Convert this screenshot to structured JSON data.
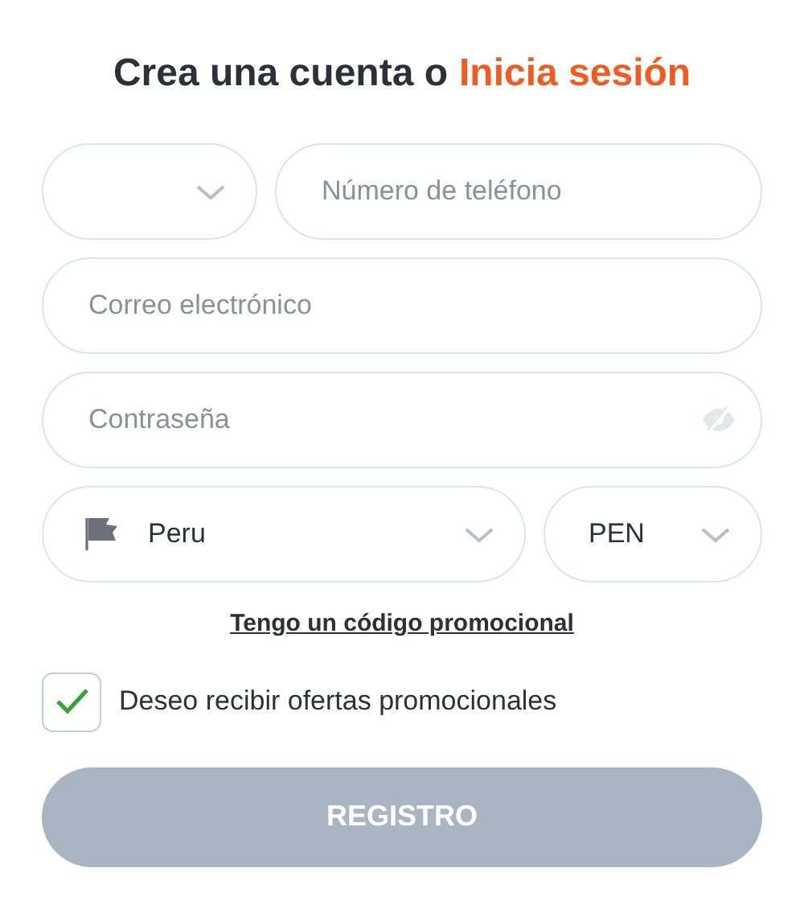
{
  "heading": {
    "text": "Crea una cuenta o",
    "link": "Inicia sesión"
  },
  "phone": {
    "placeholder": "Número de teléfono"
  },
  "email": {
    "placeholder": "Correo electrónico"
  },
  "password": {
    "placeholder": "Contraseña"
  },
  "country": {
    "value": "Peru"
  },
  "currency": {
    "value": "PEN"
  },
  "promo_link": "Tengo un código promocional",
  "offers_checkbox": {
    "label": "Deseo recibir ofertas promocionales",
    "checked": true
  },
  "register_button": {
    "label": "REGISTRO",
    "disabled": true
  }
}
